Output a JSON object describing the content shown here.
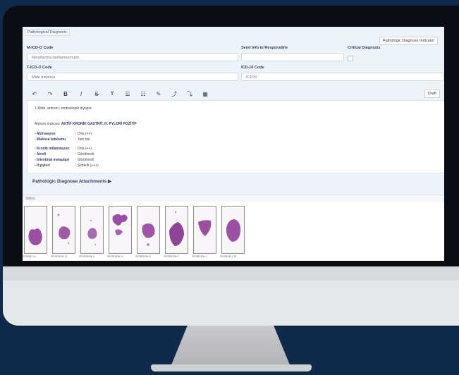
{
  "tab_label": "Pathological Diagnosis",
  "indicator_button": "Pathologic Diagnose Indicator",
  "fields": {
    "micd_label": "M-ICD-O Code",
    "micd_value": "Neoplazma rastlanmamıştır.",
    "send_label": "Send Info to Responsible",
    "critical_label": "Critical Diagnosis",
    "ticd_label": "T-ICD-O Code",
    "ticd_value": "Mide korpusu",
    "icd10_label": "ICD-10 Code",
    "icd10_placeholder": "ICD10"
  },
  "toolbar": {
    "draft_label": "Draft",
    "icons": [
      "undo-icon",
      "redo-icon",
      "bold-icon",
      "italic-icon",
      "strikethrough-icon",
      "text-format-icon",
      "bullet-list-icon",
      "numbered-list-icon",
      "brush-icon",
      "line-up-icon",
      "line-down-icon",
      "table-icon"
    ]
  },
  "editor": {
    "line1": "1-Mide, antrum ; endoskopik biyopsi:",
    "line2_prefix": "Antrum mukoza:",
    "line2_bold": "AKTİF KRONİK GASTRİT,  H. PYLORİ  POZİTİF",
    "rows": [
      {
        "key": "- Aktivasyon",
        "val": ": Orta (++)"
      },
      {
        "key": "- Mukoza tutulumu",
        "val": ": Tam kat"
      },
      {
        "key": "- Kronik inflamasyon",
        "val": ": Orta (++)"
      },
      {
        "key": "- Atrofi",
        "val": ": Görülmedi"
      },
      {
        "key": "- İntestinal metaplazi",
        "val": ": Görülmedi"
      },
      {
        "key": "- H.pylori",
        "val": ": Şiddetli (+++)"
      }
    ]
  },
  "attachments_label": "Pathologic Diagnose Attachments",
  "slides_label": "Slides",
  "slides": [
    {
      "label": "2229541 1L"
    },
    {
      "label": "2019H5036 1J"
    },
    {
      "label": "2019H5036 II"
    },
    {
      "label": "2019B1306 H"
    },
    {
      "label": "2019B1306 G"
    },
    {
      "label": "2019B1306 F"
    },
    {
      "label": "2019B1306 C"
    },
    {
      "label": "2019B2811 1E"
    }
  ],
  "colors": {
    "background": "#0f2a4a",
    "panel": "#eef2f9",
    "tissue": "#9a4fa3"
  }
}
